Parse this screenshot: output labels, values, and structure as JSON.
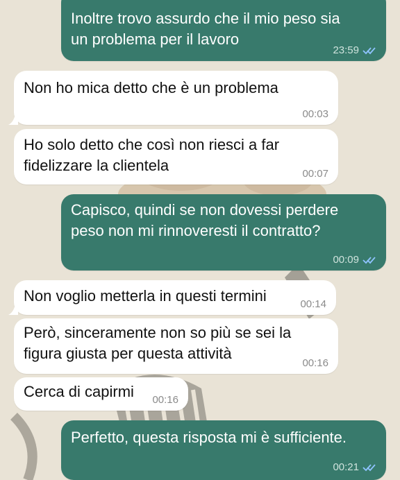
{
  "colors": {
    "outgoing_bubble": "#387a6c",
    "incoming_bubble": "#ffffff",
    "read_ticks": "#8fc3ff",
    "wallpaper": "#e9e3d6"
  },
  "messages": [
    {
      "direction": "outgoing",
      "text": "Inoltre trovo assurdo che il mio peso sia\nun problema per il lavoro",
      "time": "23:59",
      "status_icon": "double-check-read-icon"
    },
    {
      "direction": "incoming",
      "text": "Non ho mica detto che è un problema",
      "time": "00:03"
    },
    {
      "direction": "incoming",
      "text": "Ho solo detto che così non riesci a far\nfidelizzare la clientela",
      "time": "00:07"
    },
    {
      "direction": "outgoing",
      "text": "Capisco, quindi se non dovessi perdere\npeso non mi rinnoveresti il contratto?",
      "time": "00:09",
      "status_icon": "double-check-read-icon"
    },
    {
      "direction": "incoming",
      "text": "Non voglio metterla in questi termini",
      "time": "00:14"
    },
    {
      "direction": "incoming",
      "text": "Però, sinceramente non so più se sei la\nfigura giusta per questa attività",
      "time": "00:16"
    },
    {
      "direction": "incoming",
      "text": "Cerca di capirmi",
      "time": "00:16"
    },
    {
      "direction": "outgoing",
      "text": "Perfetto, questa risposta mi è sufficiente.",
      "time": "00:21",
      "status_icon": "double-check-read-icon"
    }
  ]
}
